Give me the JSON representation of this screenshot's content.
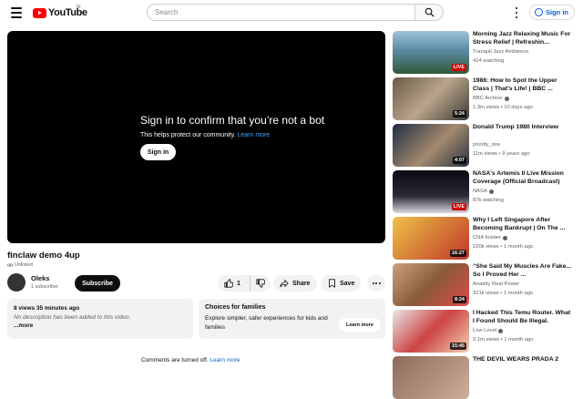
{
  "header": {
    "logo_text": "YouTube",
    "logo_country": "IE",
    "search_placeholder": "Search",
    "sign_in_label": "Sign in"
  },
  "player": {
    "message_title": "Sign in to confirm that you’re not a bot",
    "message_sub": "This helps protect our community.",
    "learn_more": "Learn more",
    "sign_in_label": "Sign in"
  },
  "video": {
    "title": "finclaw demo 4up",
    "visibility": "Unlisted",
    "channel_name": "Oleks",
    "subscribers": "1 subscriber",
    "subscribe_label": "Subscribe",
    "likes": "1",
    "share_label": "Share",
    "save_label": "Save"
  },
  "description": {
    "stats": "8 views  35 minutes ago",
    "text": "No description has been added to this video.",
    "more": "...more"
  },
  "choices": {
    "title": "Choices for families",
    "text": "Explore simpler, safer experiences for kids and families",
    "button": "Learn more"
  },
  "comments": {
    "text": "Comments are turned off.",
    "link": "Learn more"
  },
  "recommendations": [
    {
      "title": "Morning Jazz Relaxing Music For Stress Relief | Refreshin...",
      "channel": "Tranquil Jazz Ambience",
      "meta": "414 watching",
      "badge": "LIVE",
      "live": true,
      "verified": false
    },
    {
      "title": "1986: How to Spot the Upper Class | That's Life! | BBC ...",
      "channel": "BBC Archive",
      "meta": "1.3m views • 10 days ago",
      "badge": "5:24",
      "live": false,
      "verified": true
    },
    {
      "title": "Donald Trump 1980 Interview",
      "channel": "priority_one",
      "meta": "11m views • 9 years ago",
      "badge": "4:07",
      "live": false,
      "verified": false
    },
    {
      "title": "NASA's Artemis II Live Mission Coverage (Official Broadcast)",
      "channel": "NASA",
      "meta": "87k watching",
      "badge": "LIVE",
      "live": true,
      "verified": true
    },
    {
      "title": "Why I Left Singapore After Becoming Bankrupt | On The ...",
      "channel": "CNA Insider",
      "meta": "220k views • 1 month ago",
      "badge": "16:27",
      "live": false,
      "verified": true
    },
    {
      "title": "“She Said My Muscles Are Fake... So I Proved Her ...",
      "channel": "Anatoly Real Power",
      "meta": "321k views • 1 month ago",
      "badge": "8:24",
      "live": false,
      "verified": false
    },
    {
      "title": "I Hacked This Temu Router. What I Found Should Be Illegal.",
      "channel": "Low Level",
      "meta": "3.1m views • 1 month ago",
      "badge": "15:45",
      "live": false,
      "verified": true
    },
    {
      "title": "THE DEVIL WEARS PRADA 2",
      "channel": "",
      "meta": "",
      "badge": "",
      "live": false,
      "verified": false
    }
  ]
}
